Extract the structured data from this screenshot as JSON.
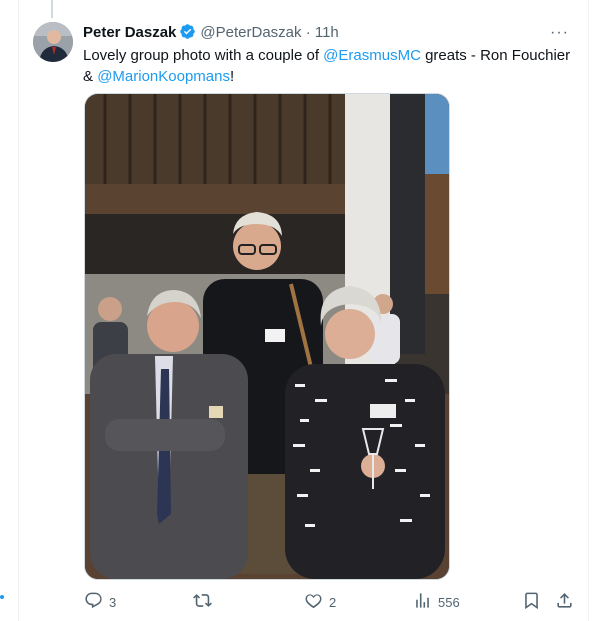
{
  "tweet": {
    "author_name": "Peter Daszak",
    "handle": "@PeterDaszak",
    "separator": "·",
    "time": "11h",
    "more_label": "···",
    "text_part1": "Lovely group photo with a couple of ",
    "mention1": "@ErasmusMC",
    "text_part2": " greats - Ron Fouchier & ",
    "mention2": "@MarionKoopmans",
    "text_part3": "!"
  },
  "actions": {
    "replies": "3",
    "retweets": "",
    "likes": "2",
    "views": "556"
  },
  "colors": {
    "accent": "#1d9bf0",
    "muted": "#536471",
    "text": "#0f1419"
  },
  "icons": [
    "verified-badge-icon",
    "more-icon",
    "reply-icon",
    "retweet-icon",
    "like-icon",
    "views-icon",
    "bookmark-icon",
    "share-icon"
  ]
}
